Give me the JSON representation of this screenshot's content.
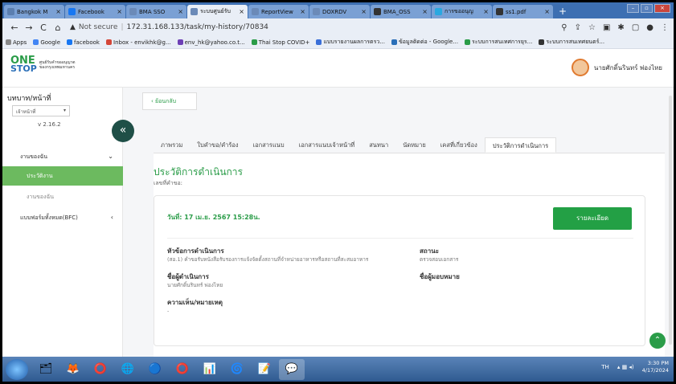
{
  "browser": {
    "tabs": [
      {
        "label": "Bangkok M",
        "fav": "#5b7fb0"
      },
      {
        "label": "Facebook",
        "fav": "#1877f2"
      },
      {
        "label": "BMA SSO",
        "fav": "#6b8ab8"
      },
      {
        "label": "ระบบศูนย์รับ",
        "fav": "#6b8ab8",
        "active": true
      },
      {
        "label": "ReportView",
        "fav": "#6b8ab8"
      },
      {
        "label": "DOXRDV",
        "fav": "#6b8ab8"
      },
      {
        "label": "BMA_OSS",
        "fav": "#333"
      },
      {
        "label": "การขออนุญ",
        "fav": "#2aa8e0"
      },
      {
        "label": "ss1.pdf",
        "fav": "#333"
      }
    ],
    "newtab": "+",
    "url_secure": "Not secure",
    "url": "172.31.168.133/task/my-history/70834",
    "bookmarks": [
      {
        "label": "Apps",
        "color": "#888"
      },
      {
        "label": "Google",
        "color": "#4285f4"
      },
      {
        "label": "facebook",
        "color": "#1877f2"
      },
      {
        "label": "Inbox - envikhk@g...",
        "color": "#d44638"
      },
      {
        "label": "env_hk@yahoo.co.t...",
        "color": "#6d3fb5"
      },
      {
        "label": "Thai Stop COVID+",
        "color": "#2a9c48"
      },
      {
        "label": "แบบรายงานผลการตรว...",
        "color": "#3a6fd8"
      },
      {
        "label": "ข้อมูลติดต่อ - Google...",
        "color": "#2a6fb8"
      },
      {
        "label": "ระบบการสนเทศการยุร...",
        "color": "#2a9c48"
      },
      {
        "label": "ระบบการสนเทศยนตร์...",
        "color": "#333"
      }
    ]
  },
  "header": {
    "logo_one": "ONE",
    "logo_stop": "STOP",
    "logo_text1": "ศูนย์รับคำขออนุญาต",
    "logo_text2": "ของกรุงเทพมหานคร",
    "user_name": "นายศักดิ์นรินทร์ พ่องไหย"
  },
  "sidebar": {
    "role_title": "บทบาท/หน้าที่",
    "role_value": "เจ้าหน้าที่",
    "version": "v 2.16.2",
    "items": [
      {
        "label": "งานของฉัน",
        "caret": "⌄"
      },
      {
        "label": "ประวัติงาน",
        "active": true
      },
      {
        "label": "งานของฉัน"
      },
      {
        "label": "แบบฟอร์มทั้งหมด(BFC)",
        "caret": "‹"
      }
    ]
  },
  "main": {
    "back_label": "ย้อนกลับ",
    "tabs": [
      "ภาพรวม",
      "ใบคำขอ/คำร้อง",
      "เอกสารแนบ",
      "เอกสารแนบเจ้าหน้าที่",
      "สนทนา",
      "นัดหมาย",
      "เคสที่เกี่ยวข้อง",
      "ประวัติการดำเนินการ"
    ],
    "active_tab": 7,
    "title": "ประวัติการดำเนินการ",
    "request_no_label": "เลขที่คำขอ:",
    "card": {
      "date": "วันที่: 17 เม.ย. 2567 15:28น.",
      "detail_button": "รายละเอียด",
      "topic_label": "หัวข้อการดำเนินการ",
      "topic_value": "(สอ.1) คำขอรับหนังสือรับรองการแจ้งจัดตั้งสถานที่จำหน่ายอาหารหรือสถานที่สะสมอาหาร",
      "status_label": "สถานะ",
      "status_value": "ตรวจสอบเอกสาร",
      "operator_label": "ชื่อผู้ดำเนินการ",
      "operator_value": "นายศักดิ์นรินทร์ พ่องไหย",
      "assignee_label": "ชื่อผู้มอบหมาย",
      "comment_label": "ความเห็น/หมายเหตุ",
      "comment_value": "-"
    }
  },
  "taskbar": {
    "apps": [
      "🗂",
      "🦊",
      "⭕",
      "🌐",
      "🔵",
      "⭕",
      "📊",
      "🌀",
      "📝",
      "💬"
    ],
    "lang": "TH",
    "time": "3:30 PM",
    "date": "4/17/2024"
  }
}
